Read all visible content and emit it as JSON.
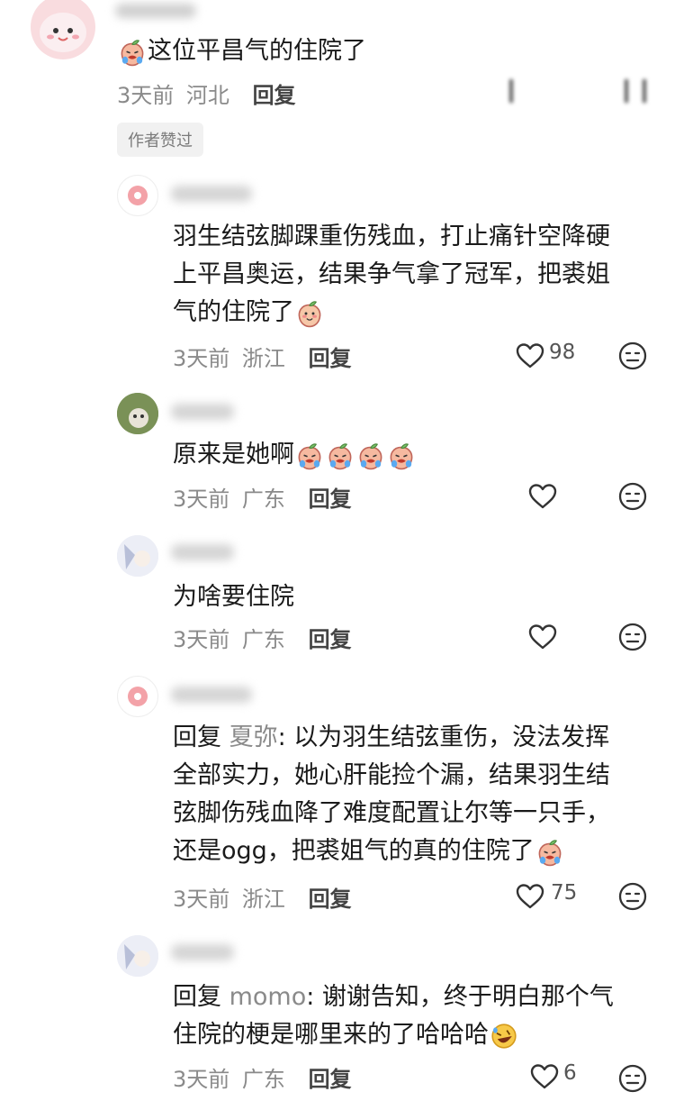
{
  "top_comment": {
    "text": "这位平昌气的住院了",
    "time": "3天前",
    "location": "河北",
    "reply_label": "回复",
    "author_liked_badge": "作者赞过"
  },
  "replies": [
    {
      "lines": [
        "羽生结弦脚踝重伤残血，打止痛针空降硬",
        "上平昌奥运，结果争气拿了冠军，把裘姐",
        "气的住院了"
      ],
      "time": "3天前",
      "location": "浙江",
      "reply_label": "回复",
      "likes": "98"
    },
    {
      "text": "原来是她啊",
      "time": "3天前",
      "location": "广东",
      "reply_label": "回复",
      "likes": ""
    },
    {
      "text": "为啥要住院",
      "time": "3天前",
      "location": "广东",
      "reply_label": "回复",
      "likes": ""
    },
    {
      "prefix": "回复",
      "mention": "夏弥",
      "lines": [
        ": 以为羽生结弦重伤，没法发挥",
        "全部实力，她心肝能捡个漏，结果羽生结",
        "弦脚伤残血降了难度配置让尔等一只手，",
        "还是ogg，把裘姐气的真的住院了"
      ],
      "time": "3天前",
      "location": "浙江",
      "reply_label": "回复",
      "likes": "75"
    },
    {
      "prefix": "回复",
      "mention": "momo",
      "lines": [
        ": 谢谢告知，终于明白那个气",
        "住院的梗是哪里来的了哈哈哈"
      ],
      "time": "3天前",
      "location": "广东",
      "reply_label": "回复",
      "likes": "6"
    }
  ],
  "colors": {
    "meta": "#8a8a8a",
    "heart_stroke": "#333333",
    "badge_bg": "#f1f1f1"
  },
  "icons": [
    "heart-icon",
    "dislike-face-icon",
    "peach-emoji-icon",
    "crying-emoji-icon",
    "rofl-emoji-icon"
  ]
}
